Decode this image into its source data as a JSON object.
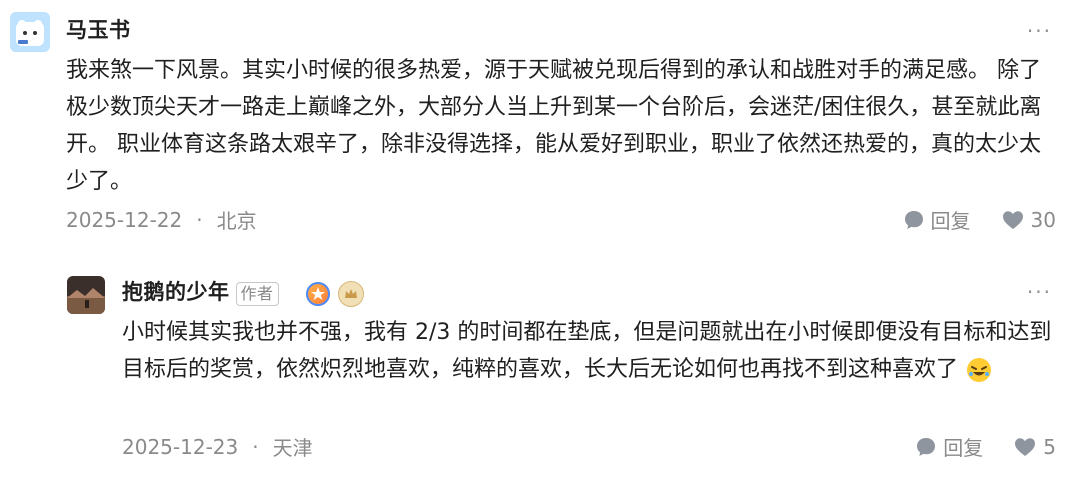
{
  "comments": [
    {
      "author": "马玉书",
      "more": "···",
      "text": "我来煞一下风景。其实小时候的很多热爱，源于天赋被兑现后得到的承认和战胜对手的满足感。 除了极少数顶尖天才一路走上巅峰之外，大部分人当上升到某一个台阶后，会迷茫/困住很久，甚至就此离开。 职业体育这条路太艰辛了，除非没得选择，能从爱好到职业，职业了依然还热爱的，真的太少太少了。",
      "date": "2025-12-22",
      "location": "北京",
      "reply_label": "回复",
      "likes": "30"
    },
    {
      "author": "抱鹅的少年",
      "author_tag": "作者",
      "more": "···",
      "text": "小时候其实我也并不强，我有 2/3 的时间都在垫底，但是问题就出在小时候即便没有目标和达到目标后的奖赏，依然炽烈地喜欢，纯粹的喜欢，长大后无论如何也再找不到这种喜欢了",
      "date": "2025-12-23",
      "location": "天津",
      "reply_label": "回复",
      "likes": "5"
    }
  ],
  "separator": "·",
  "icons": {
    "avatar1": "bear-avatar-icon",
    "avatar2": "landscape-avatar-icon",
    "reply": "chat-bubble-icon",
    "like": "heart-icon",
    "emoji": "rofl-emoji-icon",
    "badge1": "star-badge-icon",
    "badge2": "crown-badge-icon"
  },
  "colors": {
    "text": "#202020",
    "meta": "#8a8a8a",
    "background": "#ffffff"
  }
}
